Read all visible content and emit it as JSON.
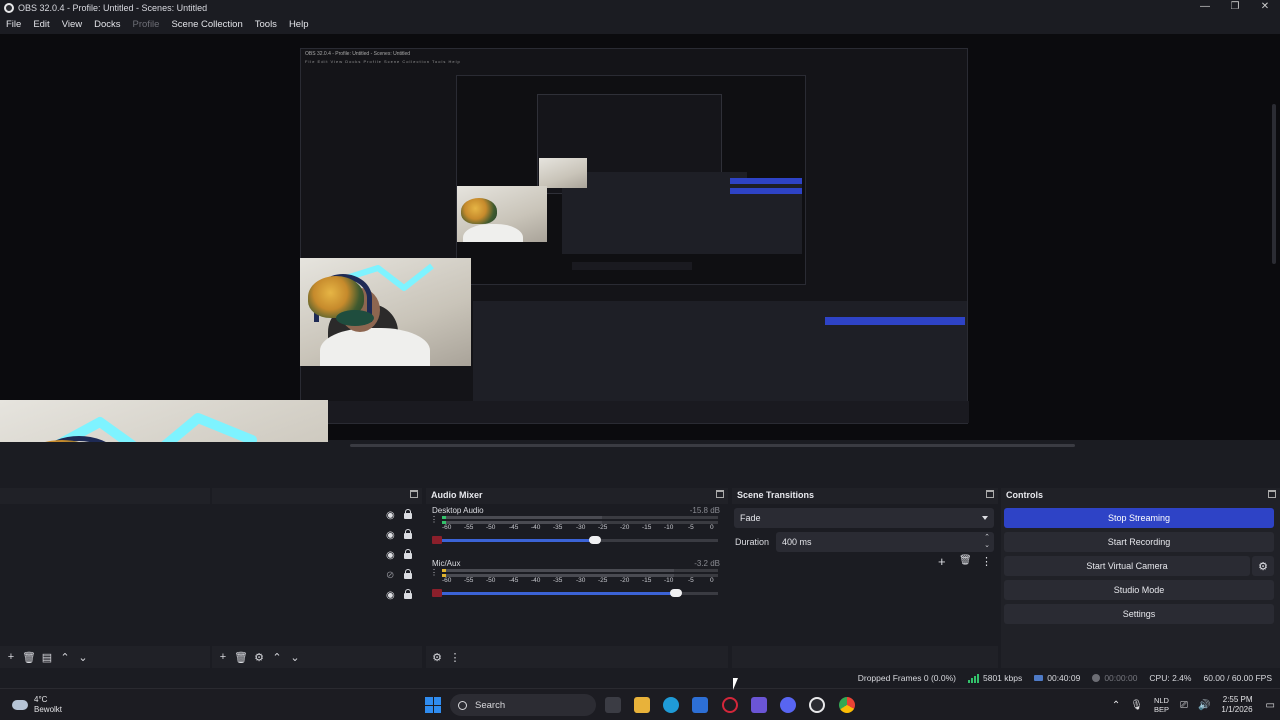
{
  "window": {
    "title": "OBS 32.0.4 - Profile: Untitled - Scenes: Untitled",
    "minimize": "—",
    "restore": "❐",
    "close": "✕"
  },
  "menu": [
    "File",
    "Edit",
    "View",
    "Docks",
    "Profile",
    "Scene Collection",
    "Tools",
    "Help"
  ],
  "preview": {
    "nested_title": "OBS 32.0.4 - Profile: Untitled - Scenes: Untitled",
    "nested_menu": "File Edit View Docks Profile Scene Collection Tools Help"
  },
  "sources": {
    "rows": [
      {
        "visible_icon": "eye-icon",
        "locked": true
      },
      {
        "visible_icon": "eye-icon",
        "locked": true
      },
      {
        "visible_icon": "eye-icon",
        "locked": true
      },
      {
        "visible_icon": "eye-slash-icon",
        "locked": true
      },
      {
        "visible_icon": "eye-icon",
        "locked": true
      }
    ]
  },
  "audio_mixer": {
    "title": "Audio Mixer",
    "channels": [
      {
        "name": "Desktop Audio",
        "db": "-15.8 dB",
        "volume_pct": 55,
        "level_pct": 2
      },
      {
        "name": "Mic/Aux",
        "db": "-3.2 dB",
        "volume_pct": 85,
        "level_pct": 2
      }
    ],
    "scale": [
      "-60",
      "-55",
      "-50",
      "-45",
      "-40",
      "-35",
      "-30",
      "-25",
      "-20",
      "-15",
      "-10",
      "-5",
      "0"
    ]
  },
  "scene_transitions": {
    "title": "Scene Transitions",
    "transition": "Fade",
    "duration_label": "Duration",
    "duration_value": "400 ms"
  },
  "controls": {
    "title": "Controls",
    "stop_streaming": "Stop Streaming",
    "start_recording": "Start Recording",
    "start_virtual_camera": "Start Virtual Camera",
    "studio_mode": "Studio Mode",
    "settings": "Settings"
  },
  "status": {
    "dropped_frames": "Dropped Frames 0 (0.0%)",
    "bitrate": "5801 kbps",
    "stream_time": "00:40:09",
    "record_time": "00:00:00",
    "cpu": "CPU: 2.4%",
    "fps": "60.00 / 60.00 FPS"
  },
  "taskbar": {
    "temperature": "4°C",
    "weather": "Bewolkt",
    "search_placeholder": "Search",
    "lang_top": "NLD",
    "lang_bottom": "BEP",
    "time": "2:55 PM",
    "date": "1/1/2026"
  },
  "colors": {
    "accent": "#2e43c6",
    "meter_green": "#33c26b",
    "mute_red": "#8b1f2b",
    "volume_blue": "#3b63d6"
  }
}
